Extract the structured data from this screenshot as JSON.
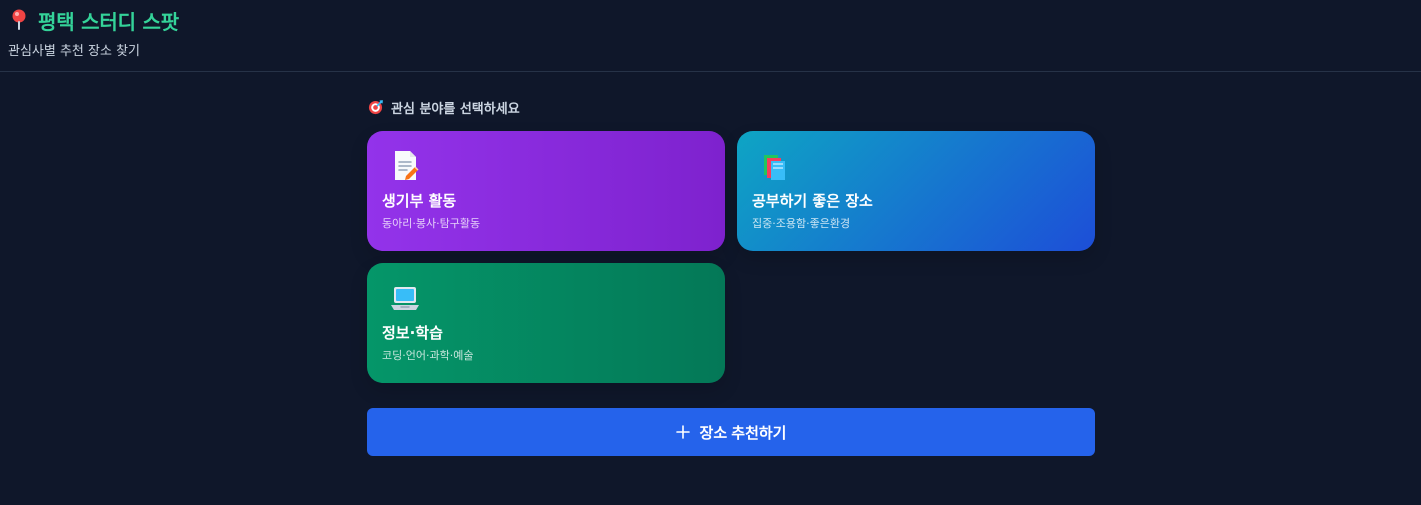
{
  "app": {
    "title": "평택 스터디 스팟",
    "subtitle": "관심사별 추천 장소 찾기",
    "icon": "pin-icon"
  },
  "section": {
    "heading": "관심 분야를 선택하세요",
    "icon": "target-icon"
  },
  "cards": [
    {
      "title": "생기부 활동",
      "description": "동아리·봉사·탐구활동",
      "icon": "memo-icon",
      "color_start": "#9333ea",
      "color_end": "#7e22ce"
    },
    {
      "title": "공부하기 좋은 장소",
      "description": "집중·조용함·좋은환경",
      "icon": "books-icon",
      "color_start": "#0ea5c4",
      "color_end": "#1d4ed8"
    },
    {
      "title": "정보·학습",
      "description": "코딩·언어·과학·예술",
      "icon": "laptop-icon",
      "color_start": "#059669",
      "color_end": "#047857"
    }
  ],
  "cta": {
    "label": "장소 추천하기",
    "icon": "plus-icon",
    "color": "#2563eb"
  },
  "colors": {
    "background": "#0f172a",
    "title": "#34d399",
    "text": "#cbd5e1"
  }
}
